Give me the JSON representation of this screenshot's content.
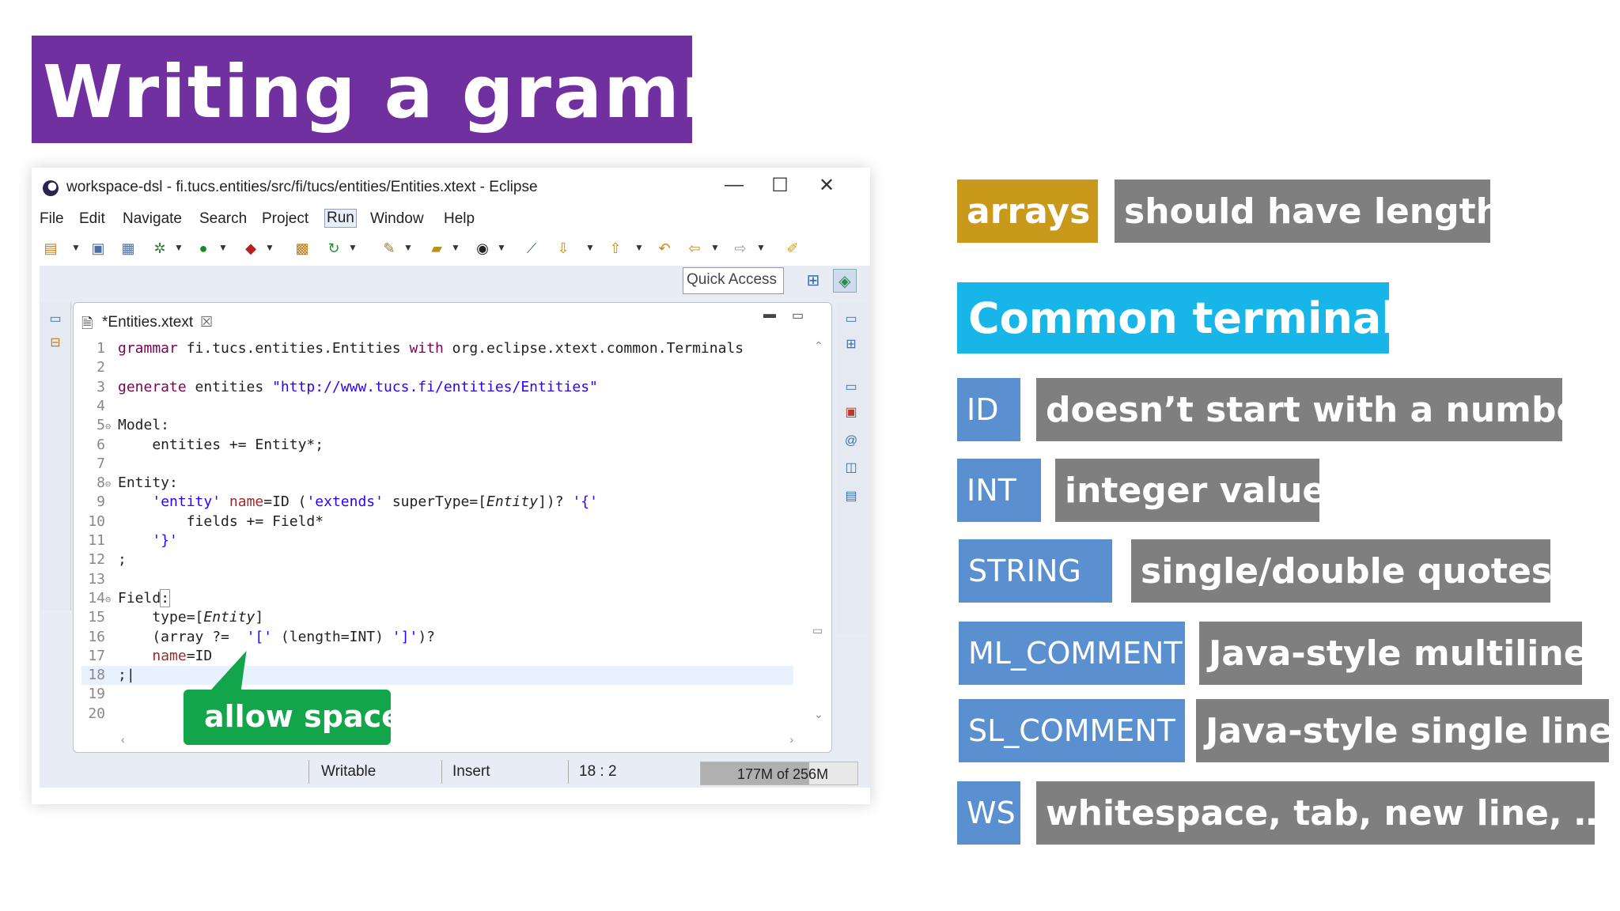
{
  "slide_title": "Writing a grammar",
  "window": {
    "title": "workspace-dsl - fi.tucs.entities/src/fi/tucs/entities/Entities.xtext - Eclipse",
    "minimize": "—",
    "maximize": "☐",
    "close": "✕"
  },
  "menu": [
    "File",
    "Edit",
    "Navigate",
    "Search",
    "Project",
    "Run",
    "Window",
    "Help"
  ],
  "quick_access": "Quick Access",
  "editor": {
    "tab_label": "*Entities.xtext",
    "tab_close": "☒"
  },
  "code_lines": [
    {
      "n": "1",
      "fold": "",
      "parts": [
        {
          "t": "grammar",
          "c": "kw"
        },
        {
          "t": " fi.tucs.entities.Entities ",
          "c": ""
        },
        {
          "t": "with",
          "c": "kw"
        },
        {
          "t": " org.eclipse.xtext.common.Terminals",
          "c": ""
        }
      ]
    },
    {
      "n": "2",
      "fold": "",
      "parts": []
    },
    {
      "n": "3",
      "fold": "",
      "parts": [
        {
          "t": "generate",
          "c": "kw"
        },
        {
          "t": " entities ",
          "c": ""
        },
        {
          "t": "\"http://www.tucs.fi/entities/Entities\"",
          "c": "str"
        }
      ]
    },
    {
      "n": "4",
      "fold": "",
      "parts": []
    },
    {
      "n": "5",
      "fold": "⊖",
      "parts": [
        {
          "t": "Model:",
          "c": ""
        }
      ]
    },
    {
      "n": "6",
      "fold": "",
      "parts": [
        {
          "t": "    entities += Entity*;",
          "c": ""
        }
      ]
    },
    {
      "n": "7",
      "fold": "",
      "parts": []
    },
    {
      "n": "8",
      "fold": "⊖",
      "parts": [
        {
          "t": "Entity:",
          "c": ""
        }
      ]
    },
    {
      "n": "9",
      "fold": "",
      "parts": [
        {
          "t": "    ",
          "c": ""
        },
        {
          "t": "'entity'",
          "c": "str"
        },
        {
          "t": " ",
          "c": ""
        },
        {
          "t": "name",
          "c": "var"
        },
        {
          "t": "=ID (",
          "c": ""
        },
        {
          "t": "'extends'",
          "c": "str"
        },
        {
          "t": " superType=[",
          "c": ""
        },
        {
          "t": "Entity",
          "c": "ital"
        },
        {
          "t": "])? ",
          "c": ""
        },
        {
          "t": "'{'",
          "c": "str"
        }
      ]
    },
    {
      "n": "10",
      "fold": "",
      "parts": [
        {
          "t": "        fields += Field*",
          "c": ""
        }
      ]
    },
    {
      "n": "11",
      "fold": "",
      "parts": [
        {
          "t": "    ",
          "c": ""
        },
        {
          "t": "'}'",
          "c": "str"
        }
      ]
    },
    {
      "n": "12",
      "fold": "",
      "parts": [
        {
          "t": ";",
          "c": ""
        }
      ]
    },
    {
      "n": "13",
      "fold": "",
      "parts": []
    },
    {
      "n": "14",
      "fold": "⊖",
      "parts": [
        {
          "t": "Field",
          "c": ""
        },
        {
          "t": ":",
          "c": "box"
        }
      ]
    },
    {
      "n": "15",
      "fold": "",
      "parts": [
        {
          "t": "    type=[",
          "c": ""
        },
        {
          "t": "Entity",
          "c": "ital"
        },
        {
          "t": "]",
          "c": ""
        }
      ]
    },
    {
      "n": "16",
      "fold": "",
      "parts": [
        {
          "t": "    (array ?=  ",
          "c": ""
        },
        {
          "t": "'['",
          "c": "str"
        },
        {
          "t": " (length=INT) ",
          "c": ""
        },
        {
          "t": "']'",
          "c": "str"
        },
        {
          "t": ")?",
          "c": ""
        }
      ]
    },
    {
      "n": "17",
      "fold": "",
      "parts": [
        {
          "t": "    ",
          "c": ""
        },
        {
          "t": "name",
          "c": "var"
        },
        {
          "t": "=ID",
          "c": ""
        }
      ]
    },
    {
      "n": "18",
      "fold": "",
      "parts": [
        {
          "t": ";|",
          "c": ""
        }
      ],
      "current": true
    },
    {
      "n": "19",
      "fold": "",
      "parts": []
    },
    {
      "n": "20",
      "fold": "",
      "parts": []
    }
  ],
  "status": {
    "writable": "Writable",
    "insert": "Insert",
    "position": "18 : 2",
    "heap": "177M of 256M",
    "heap_used_fraction": 0.69
  },
  "callout": "allow space",
  "legend": {
    "arrays_tag": "arrays",
    "arrays_desc": "should have length",
    "section_title": "Common terminals",
    "terminals": [
      {
        "name": "ID",
        "desc": "doesn’t start with a number"
      },
      {
        "name": "INT",
        "desc": "integer value"
      },
      {
        "name": "STRING",
        "desc": "single/double quotes"
      },
      {
        "name": "ML_COMMENT",
        "desc": "Java-style multiline"
      },
      {
        "name": "SL_COMMENT",
        "desc": "Java-style single line"
      },
      {
        "name": "WS",
        "desc": "whitespace, tab, new line, …"
      }
    ]
  },
  "colors": {
    "title_bg": "#7030a0",
    "arrays_bg": "#c8991a",
    "common_bg": "#18b6e8",
    "terminal_bg": "#5a8fd0",
    "desc_bg": "#7f7f7f",
    "callout_bg": "#12a54a"
  }
}
